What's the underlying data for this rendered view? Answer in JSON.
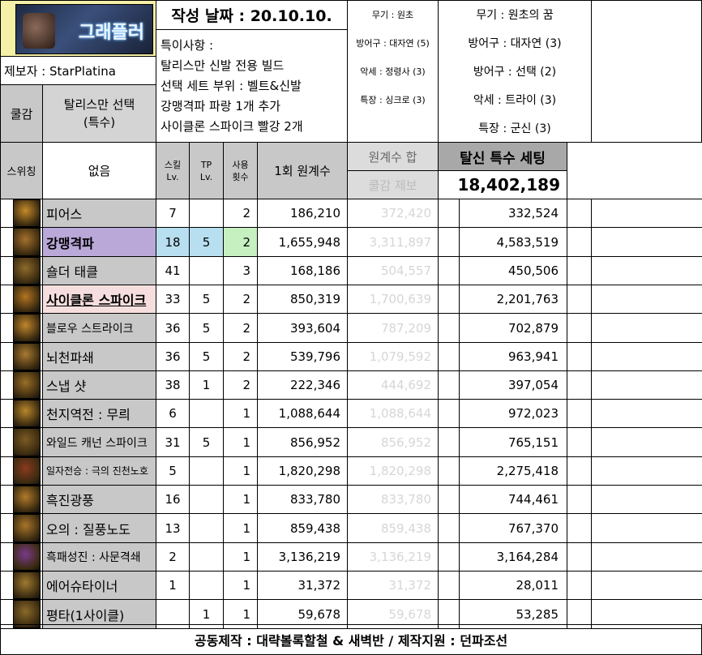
{
  "logo_text": "그래플러",
  "reporter": "제보자 : StarPlatina",
  "date": "작성 날짜 : 20.10.10.",
  "notes": [
    "특이사항 :",
    "탈리스만 신발 전용 빌드",
    "선택 세트 부위 : 벨트&신발",
    "강맹격파 파랑 1개 추가",
    "사이클론 스파이크 빨강 2개"
  ],
  "cool_label": "쿨감",
  "cool_value": [
    "탈리스만 선택",
    "(특수)"
  ],
  "set_left": [
    "무기 : 원초",
    "방어구 : 대자연 (5)",
    "악세 : 정령사 (3)",
    "특장 : 싱크로 (3)"
  ],
  "set_right": [
    "무기 : 원초의 꿈",
    "방어구 : 대자연 (3)",
    "방어구 : 선택 (2)",
    "악세 : 트라이 (3)",
    "특장 : 군신 (3)"
  ],
  "headers": {
    "switching": "스위칭",
    "none": "없음",
    "skill_lv": [
      "스킬",
      "Lv."
    ],
    "tp_lv": [
      "TP",
      "Lv."
    ],
    "uses": [
      "사용",
      "횟수"
    ],
    "per_use": "1회 원계수",
    "sum": "원계수 합",
    "cool_report": "쿨감 제보",
    "setting": "탈신 특수 세팅",
    "total": "18,402,189"
  },
  "rows": [
    {
      "name": "피어스",
      "lv": "7",
      "tp": "",
      "uses": "2",
      "per": "186,210",
      "sum": "372,420",
      "final": "332,524",
      "icon": "pierce-icon",
      "c": "#c48a2a"
    },
    {
      "name": "강맹격파",
      "lv": "18",
      "tp": "5",
      "uses": "2",
      "per": "1,655,948",
      "sum": "3,311,897",
      "final": "4,583,519",
      "icon": "gangmaeng-icon",
      "c": "#a4702c"
    },
    {
      "name": "숄더 태클",
      "lv": "41",
      "tp": "",
      "uses": "3",
      "per": "168,186",
      "sum": "504,557",
      "final": "450,506",
      "icon": "shoulder-tackle-icon",
      "c": "#8e6a2a"
    },
    {
      "name": "사이클론 스파이크",
      "lv": "33",
      "tp": "5",
      "uses": "2",
      "per": "850,319",
      "sum": "1,700,639",
      "final": "2,201,763",
      "icon": "cyclone-spike-icon",
      "c": "#b37420"
    },
    {
      "name": "블로우 스트라이크",
      "lv": "36",
      "tp": "5",
      "uses": "2",
      "per": "393,604",
      "sum": "787,209",
      "final": "702,879",
      "icon": "blow-strike-icon",
      "c": "#c0862a"
    },
    {
      "name": "뇌천파쇄",
      "lv": "36",
      "tp": "5",
      "uses": "2",
      "per": "539,796",
      "sum": "1,079,592",
      "final": "963,941",
      "icon": "noecheon-icon",
      "c": "#a87a30"
    },
    {
      "name": "스냅 샷",
      "lv": "38",
      "tp": "1",
      "uses": "2",
      "per": "222,346",
      "sum": "444,692",
      "final": "397,054",
      "icon": "snap-shot-icon",
      "c": "#9a6e26"
    },
    {
      "name": "천지역전 : 무릐",
      "lv": "6",
      "tp": "",
      "uses": "1",
      "per": "1,088,644",
      "sum": "1,088,644",
      "final": "972,023",
      "icon": "cheonji-icon",
      "c": "#b8862c"
    },
    {
      "name": "와일드 캐넌 스파이크",
      "lv": "31",
      "tp": "5",
      "uses": "1",
      "per": "856,952",
      "sum": "856,952",
      "final": "765,151",
      "icon": "wild-cannon-icon",
      "c": "#7a5a22"
    },
    {
      "name": "일자전승 : 극의 진천노호",
      "lv": "5",
      "tp": "",
      "uses": "1",
      "per": "1,820,298",
      "sum": "1,820,298",
      "final": "2,275,418",
      "icon": "iljajeonseung-icon",
      "c": "#8a3a1e"
    },
    {
      "name": "흑진광풍",
      "lv": "16",
      "tp": "",
      "uses": "1",
      "per": "833,780",
      "sum": "833,780",
      "final": "744,461",
      "icon": "heukjin-icon",
      "c": "#b07a2a"
    },
    {
      "name": "오의 : 질풍노도",
      "lv": "13",
      "tp": "",
      "uses": "1",
      "per": "859,438",
      "sum": "859,438",
      "final": "767,370",
      "icon": "ohui-icon",
      "c": "#a8762a"
    },
    {
      "name": "흑패성진 : 사문격쇄",
      "lv": "2",
      "tp": "",
      "uses": "1",
      "per": "3,136,219",
      "sum": "3,136,219",
      "final": "3,164,284",
      "icon": "heukpae-icon",
      "c": "#7a3a8a"
    },
    {
      "name": "에어슈타이너",
      "lv": "1",
      "tp": "",
      "uses": "1",
      "per": "31,372",
      "sum": "31,372",
      "final": "28,011",
      "icon": "air-steiner-icon",
      "c": "#a07a30"
    },
    {
      "name": "평타(1사이클)",
      "lv": "",
      "tp": "1",
      "uses": "1",
      "per": "59,678",
      "sum": "59,678",
      "final": "53,285",
      "icon": "basic-attack-icon",
      "c": "#8a6a2a"
    }
  ],
  "footer": "공동제작 : 대략볼록할철 & 새벽반 / 제작지원 : 던파조선"
}
